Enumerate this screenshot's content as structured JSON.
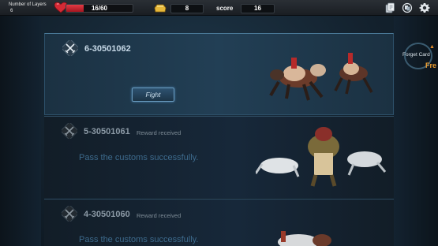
{
  "topbar": {
    "layers_title": "Number of Layers",
    "layers_value": "6",
    "hp_text": "16/60",
    "hp_fraction": 0.267,
    "gold_value": "8",
    "score_label": "score",
    "score_value": "16",
    "icons": [
      "card-deck-icon",
      "cards-swap-icon",
      "gear-icon"
    ]
  },
  "cards": [
    {
      "id": "6-30501062",
      "state": "active",
      "fight_label": "Fight"
    },
    {
      "id": "5-30501061",
      "state": "done",
      "reward_label": "Reward received",
      "pass_text": "Pass the customs successfully."
    },
    {
      "id": "4-30501060",
      "state": "done",
      "reward_label": "Reward received",
      "pass_text": "Pass the customs successfully."
    }
  ],
  "right_panel": {
    "forget_label": "Forget Card",
    "free_label": "Fre"
  },
  "colors": {
    "hp": "#d52a35",
    "gold": "#e6b83a",
    "accent": "#6a9cc0",
    "free": "#f2a030"
  }
}
